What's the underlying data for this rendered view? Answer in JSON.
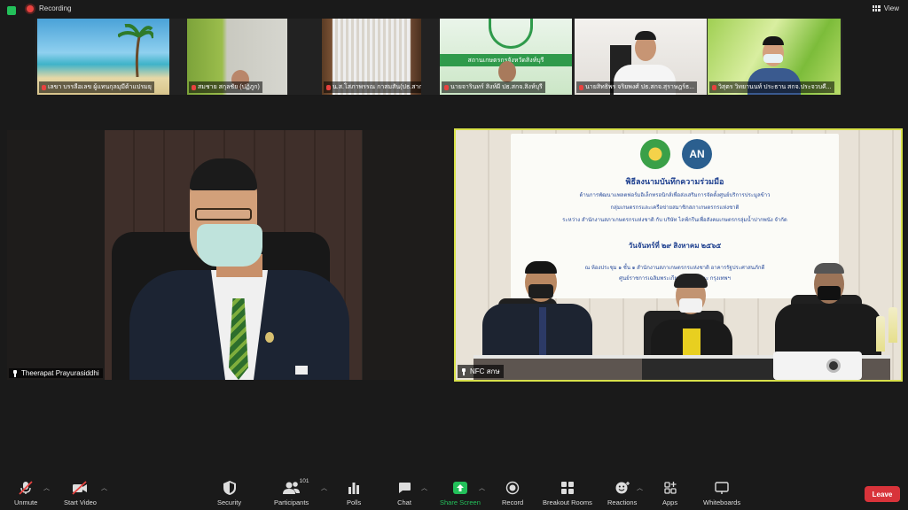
{
  "topbar": {
    "recording_label": "Recording",
    "view_label": "View"
  },
  "gallery": [
    {
      "name": "เลขา บรรลือเลข ผู้แทนกุลมุมีด้าแปรมยุ"
    },
    {
      "name": "สมชาย สกุลชัย (ปฏิภูก)"
    },
    {
      "name": "น.ส.โสภาพรรณ กาสมสัน(ปธ.สาก)"
    },
    {
      "name": "นายจารินทร์ สิงห์ผี ปธ.สกจ.สิงห์บุรี"
    },
    {
      "name": "นายสิทธิพร จริยพงศ์ ปธ.สกจ.สุราษฎร์ธ..."
    },
    {
      "name": "วิสุตร วิทยานนท์ ประธาน สกจ.ประจวบคี..."
    }
  ],
  "thumb_overlay": {
    "t4_text": "สถานเกษตรกรจังหวัดสิงห์บุรี"
  },
  "main_left": {
    "name": "Theerapat  Prayurasiddhi"
  },
  "main_right": {
    "name": "NFC สกษ",
    "logo_b": "AN",
    "banner_lines": [
      "พิธีลงนามบันทึกความร่วมมือ",
      "ด้านการพัฒนาแพลตฟอร์มอิเล็กทรอนิกส์เพื่อส่งเสริมการจัดตั้งศูนย์บริการประมูลข้าว",
      "กลุ่มเกษตรกรและเครือข่ายสมาชิกสภาเกษตรกรแห่งชาติ",
      "ระหว่าง สำนักงานสภาเกษตรกรแห่งชาติ กับ บริษัท ไลฟ์กรีนเพื่อสังคมเกษตรกรลุ่มน้ำปากพนัง จำกัด",
      "วันจันทร์ที่ ๒๙ สิงหาคม ๒๕๖๕",
      "ณ ห้องประชุม ๑ ชั้น ๑ สำนักงานสภาเกษตรกรแห่งชาติ อาคารรัฐประศาสนภักดี",
      "ศูนย์ราชการเฉลิมพระเกียรติ แจ้งวัฒนะ กรุงเทพฯ"
    ]
  },
  "toolbar": {
    "unmute": "Unmute",
    "start_video": "Start Video",
    "security": "Security",
    "participants": "Participants",
    "participants_count": "101",
    "polls": "Polls",
    "chat": "Chat",
    "share_screen": "Share Screen",
    "record": "Record",
    "breakout_rooms": "Breakout Rooms",
    "reactions": "Reactions",
    "apps": "Apps",
    "whiteboards": "Whiteboards",
    "leave": "Leave"
  },
  "colors": {
    "accent_green": "#23c05a",
    "active_border": "#d8e14a",
    "leave_red": "#d8333a",
    "muted_red": "#e8423f"
  }
}
